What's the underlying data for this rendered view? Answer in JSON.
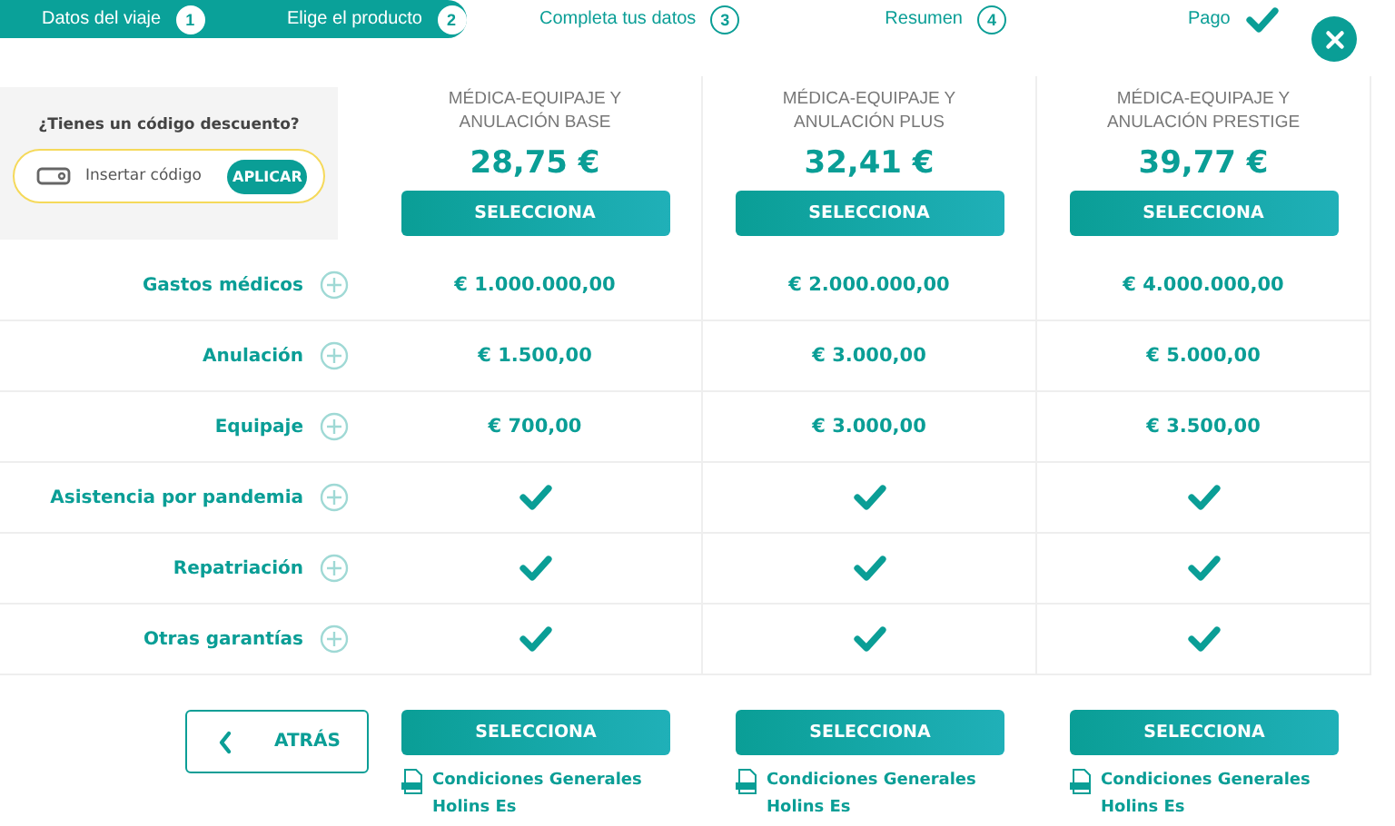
{
  "steps": [
    {
      "label": "Datos del viaje",
      "kind": "number",
      "number": "1",
      "completed": true
    },
    {
      "label": "Elige el producto",
      "kind": "number",
      "number": "2",
      "completed": true
    },
    {
      "label": "Completa tus datos",
      "kind": "number",
      "number": "3",
      "completed": false
    },
    {
      "label": "Resumen",
      "kind": "number",
      "number": "4",
      "completed": false
    },
    {
      "label": "Pago",
      "kind": "check",
      "completed": false
    }
  ],
  "discount": {
    "title": "¿Tienes un código descuento?",
    "placeholder": "Insertar código",
    "button": "APLICAR"
  },
  "plans": [
    {
      "title": "MÉDICA-EQUIPAJE Y ANULACIÓN BASE",
      "price": "28,75 €",
      "button": "SELECCIONA",
      "footer_button": "SELECCIONA",
      "link": "Condiciones Generales Holins Es"
    },
    {
      "title": "MÉDICA-EQUIPAJE Y ANULACIÓN PLUS",
      "price": "32,41 €",
      "button": "SELECCIONA",
      "footer_button": "SELECCIONA",
      "link": "Condiciones Generales Holins Es"
    },
    {
      "title": "MÉDICA-EQUIPAJE Y ANULACIÓN PRESTIGE",
      "price": "39,77 €",
      "button": "SELECCIONA",
      "footer_button": "SELECCIONA",
      "link": "Condiciones Generales Holins Es"
    }
  ],
  "rows": [
    {
      "label": "Gastos médicos",
      "cells": [
        {
          "kind": "text",
          "value": "€ 1.000.000,00"
        },
        {
          "kind": "text",
          "value": "€ 2.000.000,00"
        },
        {
          "kind": "text",
          "value": "€ 4.000.000,00"
        }
      ]
    },
    {
      "label": "Anulación",
      "cells": [
        {
          "kind": "text",
          "value": "€ 1.500,00"
        },
        {
          "kind": "text",
          "value": "€ 3.000,00"
        },
        {
          "kind": "text",
          "value": "€ 5.000,00"
        }
      ]
    },
    {
      "label": "Equipaje",
      "cells": [
        {
          "kind": "text",
          "value": "€ 700,00"
        },
        {
          "kind": "text",
          "value": "€ 3.000,00"
        },
        {
          "kind": "text",
          "value": "€ 3.500,00"
        }
      ]
    },
    {
      "label": "Asistencia por pandemia",
      "cells": [
        {
          "kind": "check",
          "included": true
        },
        {
          "kind": "check",
          "included": true
        },
        {
          "kind": "check",
          "included": true
        }
      ]
    },
    {
      "label": "Repatriación",
      "cells": [
        {
          "kind": "check",
          "included": true
        },
        {
          "kind": "check",
          "included": true
        },
        {
          "kind": "check",
          "included": true
        }
      ]
    },
    {
      "label": "Otras garantías",
      "cells": [
        {
          "kind": "check",
          "included": true
        },
        {
          "kind": "check",
          "included": true
        },
        {
          "kind": "check",
          "included": true
        }
      ]
    }
  ],
  "back_button": "ATRÁS"
}
